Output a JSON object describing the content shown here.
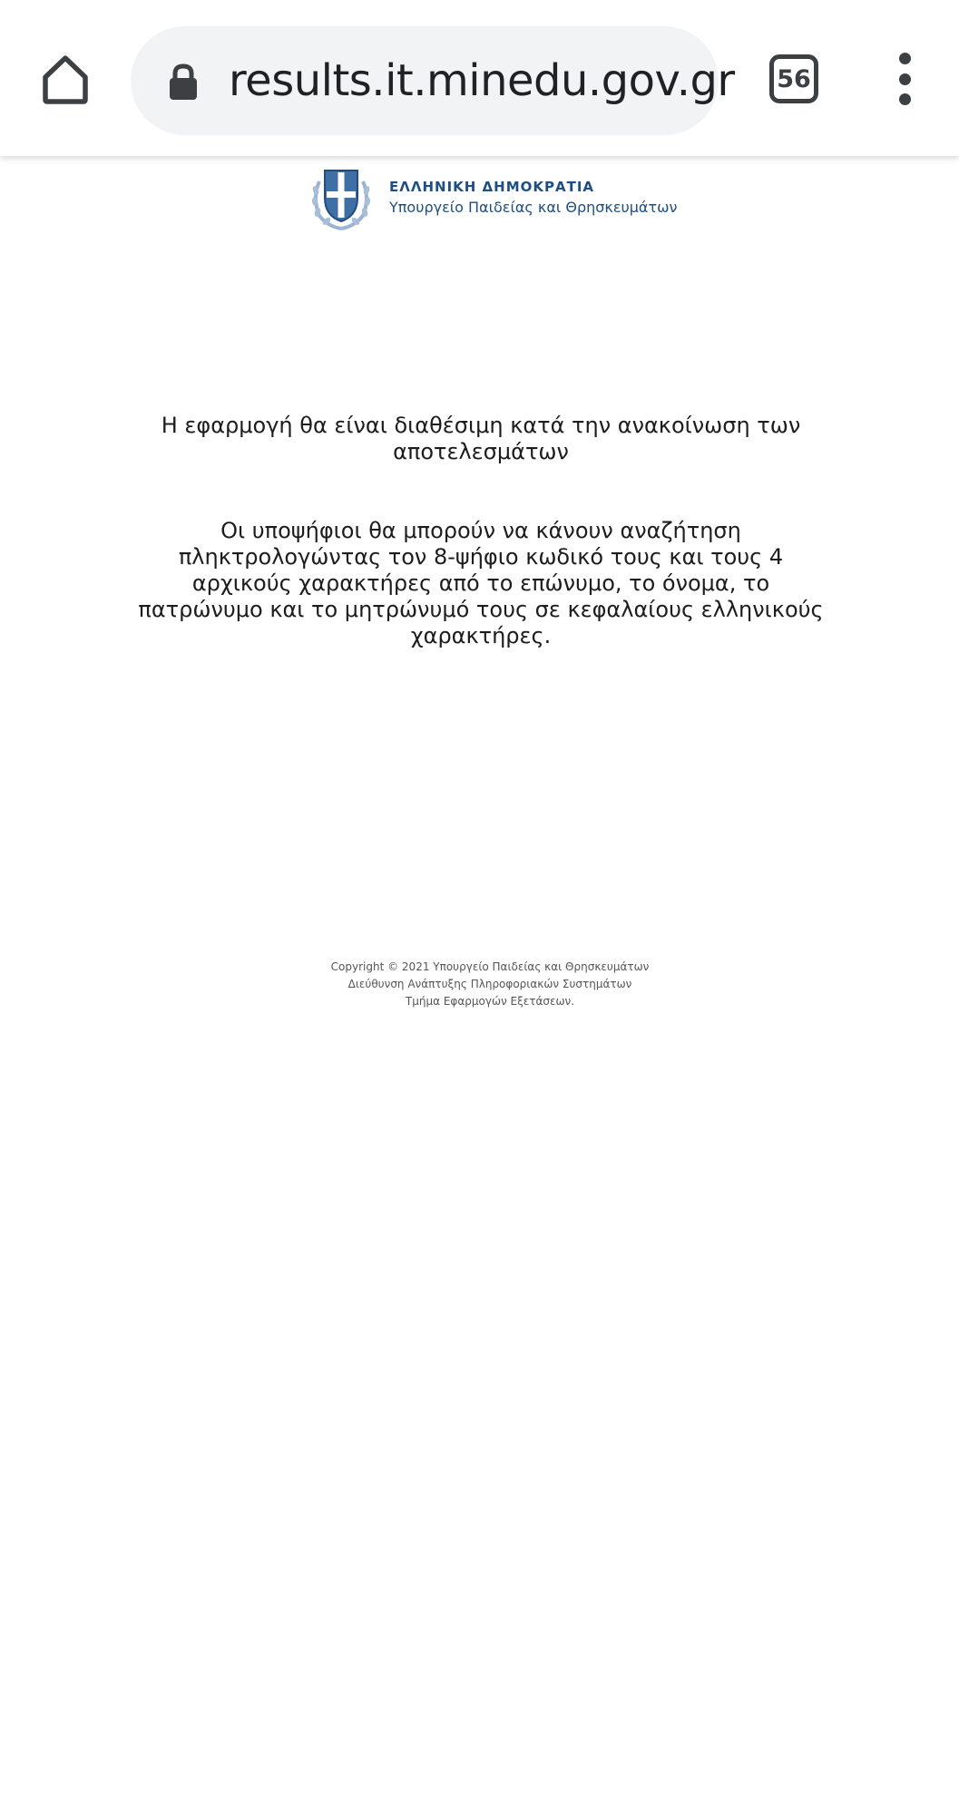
{
  "browser": {
    "url": "results.it.minedu.gov.gr",
    "tab_count": "56",
    "icons": {
      "home": "home-icon",
      "lock": "lock-icon",
      "tabs": "tab-switcher-icon",
      "menu": "more-vert-icon"
    }
  },
  "header": {
    "logo_line1": "ΕΛΛΗΝΙΚΗ ΔΗΜΟΚΡΑΤΙΑ",
    "logo_line2": "Υπουργείο Παιδείας και Θρησκευμάτων"
  },
  "main": {
    "availability_text": "Η εφαρμογή θα είναι διαθέσιμη κατά την ανακοίνωση των αποτελεσμάτων",
    "instructions_text": "Οι υποψήφιοι θα μπορούν να κάνουν αναζήτηση πληκτρολογώντας τον 8-ψήφιο κωδικό τους και τους 4 αρχικούς χαρακτήρες από το επώνυμο, το όνομα, το πατρώνυμο και το μητρώνυμό τους σε κεφαλαίους ελληνικούς χαρακτήρες."
  },
  "footer": {
    "line1": "Copyright © 2021 Υπουργείο Παιδείας και Θρησκευμάτων",
    "line2": "Διεύθυνση Ανάπτυξης Πληροφοριακών Συστημάτων",
    "line3": "Τμήμα Εφαρμογών Εξετάσεων."
  },
  "colors": {
    "brand_blue": "#1e4e82",
    "toolbar_icon": "#3c4043",
    "omnibox_bg": "#f1f3f4"
  }
}
